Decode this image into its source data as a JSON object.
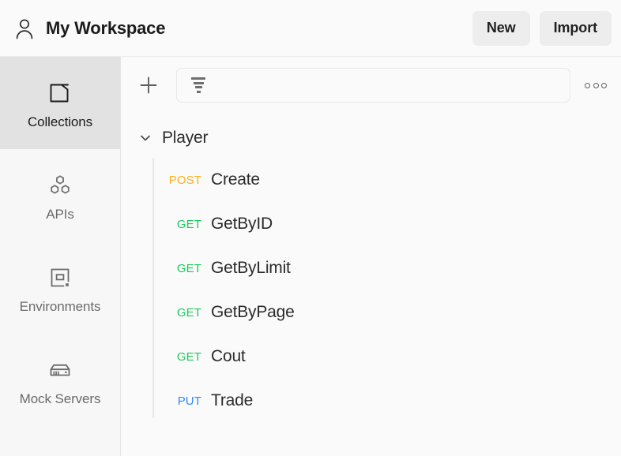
{
  "header": {
    "avatar_icon": "user-icon",
    "workspace_title": "My Workspace",
    "new_label": "New",
    "import_label": "Import"
  },
  "sidebar": {
    "items": [
      {
        "label": "Collections",
        "icon": "collections-icon",
        "active": true
      },
      {
        "label": "APIs",
        "icon": "apis-icon",
        "active": false
      },
      {
        "label": "Environments",
        "icon": "environments-icon",
        "active": false
      },
      {
        "label": "Mock Servers",
        "icon": "mock-servers-icon",
        "active": false
      }
    ]
  },
  "toolbar": {
    "add_icon": "plus-icon",
    "filter_icon": "filter-icon",
    "search_value": "",
    "search_placeholder": "",
    "more_icon": "ellipsis-icon"
  },
  "tree": {
    "folder": {
      "name": "Player",
      "expanded": true,
      "chevron_icon": "chevron-down-icon"
    },
    "requests": [
      {
        "method": "POST",
        "name": "Create"
      },
      {
        "method": "GET",
        "name": "GetByID"
      },
      {
        "method": "GET",
        "name": "GetByLimit"
      },
      {
        "method": "GET",
        "name": "GetByPage"
      },
      {
        "method": "GET",
        "name": "Cout"
      },
      {
        "method": "PUT",
        "name": "Trade"
      }
    ]
  },
  "colors": {
    "method_get": "#1ec95d",
    "method_post": "#ffb11a",
    "method_put": "#2f8bf5",
    "method_delete": "#f04438",
    "accent_active_bg": "#e2e2e2",
    "page_bg": "#fafafa",
    "button_bg": "#ededed"
  }
}
